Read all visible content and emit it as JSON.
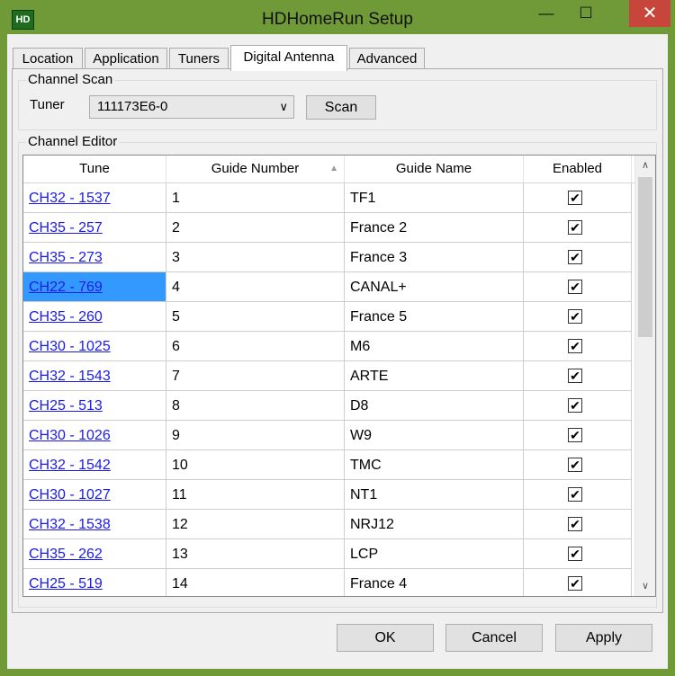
{
  "window": {
    "title": "HDHomeRun Setup",
    "icon_text": "HD",
    "min_glyph": "—",
    "max_glyph": "☐",
    "close_glyph": "✕"
  },
  "tabs": [
    {
      "label": "Location"
    },
    {
      "label": "Application"
    },
    {
      "label": "Tuners"
    },
    {
      "label": "Digital Antenna"
    },
    {
      "label": "Advanced"
    }
  ],
  "channel_scan": {
    "group_label": "Channel Scan",
    "tuner_label": "Tuner",
    "tuner_value": "111173E6-0",
    "scan_label": "Scan"
  },
  "channel_editor": {
    "group_label": "Channel Editor",
    "columns": {
      "tune": "Tune",
      "guide_number": "Guide Number",
      "guide_name": "Guide Name",
      "enabled": "Enabled"
    },
    "rows": [
      {
        "tune": "CH32 - 1537",
        "number": "1",
        "name": "TF1",
        "enabled": "✔"
      },
      {
        "tune": "CH35 - 257",
        "number": "2",
        "name": "France 2",
        "enabled": "✔"
      },
      {
        "tune": "CH35 - 273",
        "number": "3",
        "name": "France 3",
        "enabled": "✔"
      },
      {
        "tune": "CH22 - 769",
        "number": "4",
        "name": "CANAL+",
        "enabled": "✔"
      },
      {
        "tune": "CH35 - 260",
        "number": "5",
        "name": "France 5",
        "enabled": "✔"
      },
      {
        "tune": "CH30 - 1025",
        "number": "6",
        "name": "M6",
        "enabled": "✔"
      },
      {
        "tune": "CH32 - 1543",
        "number": "7",
        "name": "ARTE",
        "enabled": "✔"
      },
      {
        "tune": "CH25 - 513",
        "number": "8",
        "name": "D8",
        "enabled": "✔"
      },
      {
        "tune": "CH30 - 1026",
        "number": "9",
        "name": "W9",
        "enabled": "✔"
      },
      {
        "tune": "CH32 - 1542",
        "number": "10",
        "name": "TMC",
        "enabled": "✔"
      },
      {
        "tune": "CH30 - 1027",
        "number": "11",
        "name": "NT1",
        "enabled": "✔"
      },
      {
        "tune": "CH32 - 1538",
        "number": "12",
        "name": "NRJ12",
        "enabled": "✔"
      },
      {
        "tune": "CH35 - 262",
        "number": "13",
        "name": "LCP",
        "enabled": "✔"
      },
      {
        "tune": "CH25 - 519",
        "number": "14",
        "name": "France 4",
        "enabled": "✔"
      }
    ]
  },
  "buttons": {
    "ok": "OK",
    "cancel": "Cancel",
    "apply": "Apply"
  },
  "colors": {
    "frame": "#6f9a37",
    "close": "#c7453b",
    "link": "#1a1aee",
    "selection": "#3399ff"
  }
}
